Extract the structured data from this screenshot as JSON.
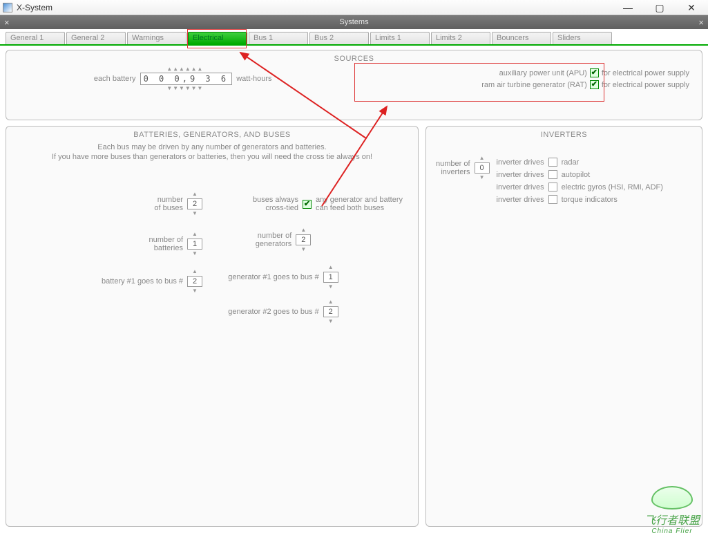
{
  "window": {
    "title": "X-System",
    "subbar_title": "Systems"
  },
  "tabs": [
    {
      "label": "General 1",
      "active": false
    },
    {
      "label": "General 2",
      "active": false
    },
    {
      "label": "Warnings",
      "active": false
    },
    {
      "label": "Electrical",
      "active": true
    },
    {
      "label": "Bus 1",
      "active": false
    },
    {
      "label": "Bus 2",
      "active": false
    },
    {
      "label": "Limits 1",
      "active": false
    },
    {
      "label": "Limits 2",
      "active": false
    },
    {
      "label": "Bouncers",
      "active": false
    },
    {
      "label": "Sliders",
      "active": false
    }
  ],
  "sources": {
    "title": "SOURCES",
    "battery_label_left": "each battery",
    "battery_value": "0 0 0,9 3 6",
    "battery_label_right": "watt-hours",
    "apu": {
      "label_left": "auxiliary power unit (APU)",
      "checked": true,
      "label_right": "for electrical power supply"
    },
    "rat": {
      "label_left": "ram air turbine generator (RAT)",
      "checked": true,
      "label_right": "for electrical power supply"
    }
  },
  "bgb": {
    "title": "BATTERIES, GENERATORS, AND BUSES",
    "note1": "Each bus may be driven by any number of generators and batteries.",
    "note2": "If you have more buses than generators or batteries, then you will need the cross tie always on!",
    "num_buses": {
      "label": "number\nof buses",
      "value": "2"
    },
    "cross_tied": {
      "label_left": "buses always\ncross-tied",
      "checked": true,
      "label_right": "any generator and battery\ncan feed both buses"
    },
    "num_batteries": {
      "label": "number of\nbatteries",
      "value": "1"
    },
    "num_generators": {
      "label": "number of\ngenerators",
      "value": "2"
    },
    "bat1_bus": {
      "label": "battery #1 goes to bus #",
      "value": "2"
    },
    "gen1_bus": {
      "label": "generator #1 goes to bus #",
      "value": "1"
    },
    "gen2_bus": {
      "label": "generator #2 goes to bus #",
      "value": "2"
    }
  },
  "inverters": {
    "title": "INVERTERS",
    "num": {
      "label": "number of\ninverters",
      "value": "0"
    },
    "drives_label": "inverter drives",
    "items": [
      {
        "checked": false,
        "label": "radar"
      },
      {
        "checked": false,
        "label": "autopilot"
      },
      {
        "checked": false,
        "label": "electric gyros (HSI, RMI, ADF)"
      },
      {
        "checked": false,
        "label": "torque indicators"
      }
    ]
  },
  "watermark": {
    "line1": "飞行者联盟",
    "line2": "China Flier"
  }
}
